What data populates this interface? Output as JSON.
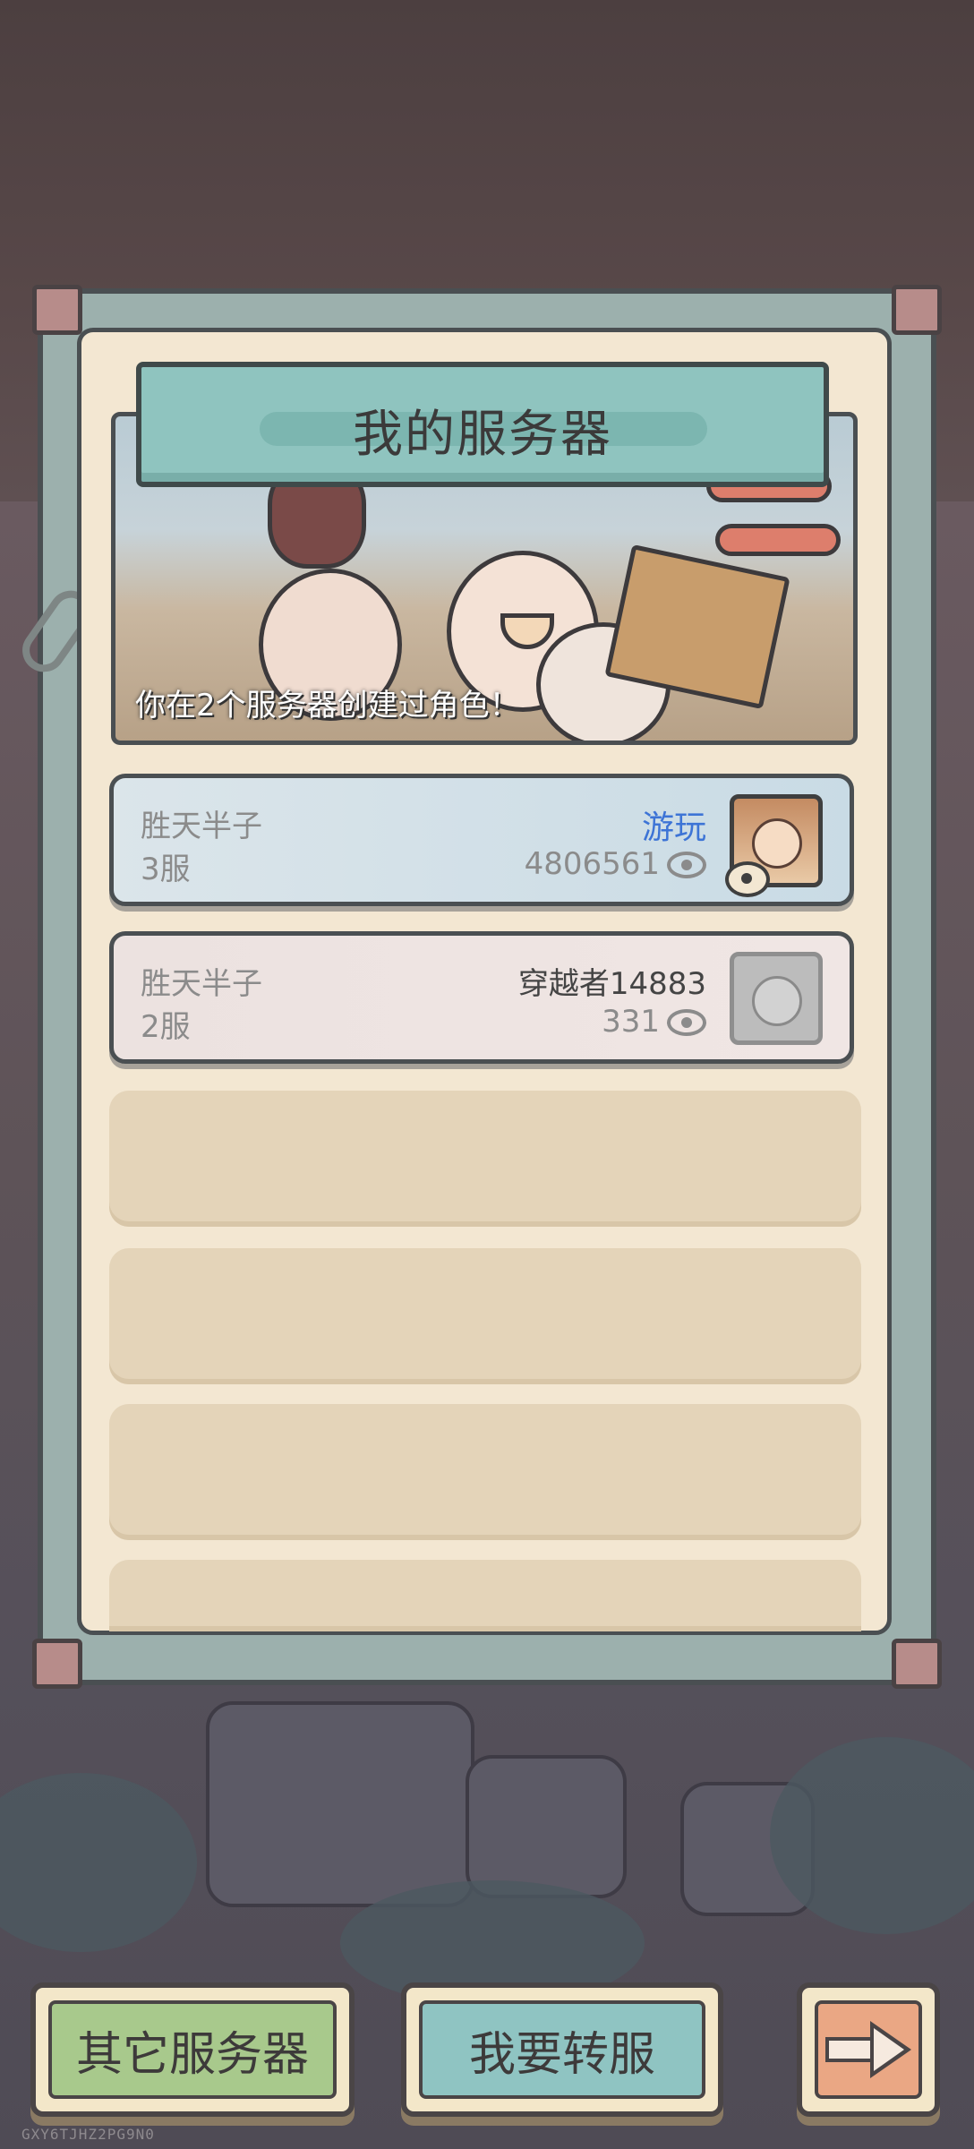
{
  "panel": {
    "title": "我的服务器",
    "banner_text": "你在2个服务器创建过角色！"
  },
  "servers": [
    {
      "name": "胜天半子",
      "zone": "3服",
      "status": "游玩",
      "views": "4806561",
      "avatar_icon": "player-avatar-icon"
    },
    {
      "name": "胜天半子",
      "zone": "2服",
      "role_name": "穿越者14883",
      "views": "331",
      "avatar_icon": "default-avatar-icon"
    }
  ],
  "buttons": {
    "other_servers": "其它服务器",
    "transfer_server": "我要转服",
    "next_icon": "arrow-right-icon"
  },
  "footer": {
    "device_code": "GXY6TJHZ2PG9N0"
  },
  "colors": {
    "status_accent": "#3d74d6",
    "title_plate": "#8fc4bf",
    "panel_bg": "#f3e7d2"
  }
}
